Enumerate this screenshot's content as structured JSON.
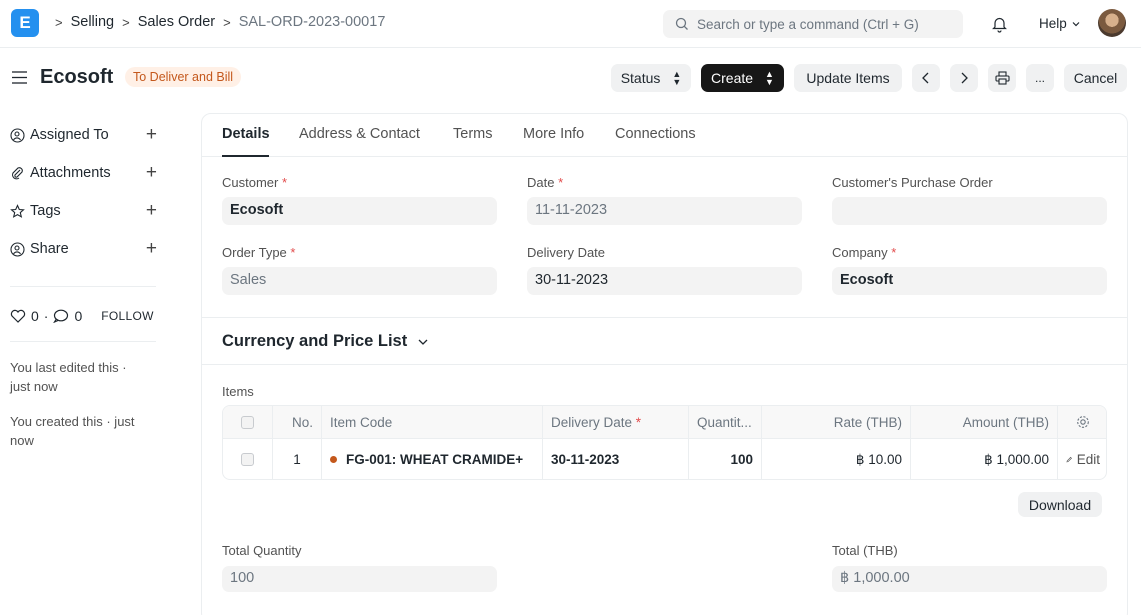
{
  "navbar": {
    "logo_letter": "E",
    "breadcrumbs": [
      "Selling",
      "Sales Order",
      "SAL-ORD-2023-00017"
    ],
    "search_placeholder": "Search or type a command (Ctrl + G)",
    "help_label": "Help"
  },
  "header": {
    "title": "Ecosoft",
    "status": "To Deliver and Bill",
    "status_label": "Status",
    "create_label": "Create",
    "update_items_label": "Update Items",
    "more_label": "...",
    "cancel_label": "Cancel"
  },
  "sidebar": {
    "items": [
      {
        "label": "Assigned To"
      },
      {
        "label": "Attachments"
      },
      {
        "label": "Tags"
      },
      {
        "label": "Share"
      }
    ],
    "likes": "0",
    "comments": "0",
    "follow": "FOLLOW",
    "last_edited": "You last edited this · just now",
    "created": "You created this · just now"
  },
  "tabs": [
    "Details",
    "Address & Contact",
    "Terms",
    "More Info",
    "Connections"
  ],
  "form": {
    "customer_label": "Customer",
    "customer": "Ecosoft",
    "date_label": "Date",
    "date": "11-11-2023",
    "cpo_label": "Customer's Purchase Order",
    "cpo": "",
    "order_type_label": "Order Type",
    "order_type": "Sales",
    "delivery_date_label": "Delivery Date",
    "delivery_date": "30-11-2023",
    "company_label": "Company",
    "company": "Ecosoft"
  },
  "currency_section": "Currency and Price List",
  "items": {
    "label": "Items",
    "columns": [
      "No.",
      "Item Code",
      "Delivery Date",
      "Quantit...",
      "Rate (THB)",
      "Amount (THB)"
    ],
    "rows": [
      {
        "no": "1",
        "item_code": "FG-001: WHEAT CRAMIDE+",
        "delivery_date": "30-11-2023",
        "qty": "100",
        "rate": "฿ 10.00",
        "amount": "฿ 1,000.00",
        "edit": "Edit"
      }
    ],
    "download_label": "Download"
  },
  "totals": {
    "total_qty_label": "Total Quantity",
    "total_qty": "100",
    "total_label": "Total (THB)",
    "total": "฿ 1,000.00"
  },
  "colors": {
    "accent": "#2490ef",
    "status": "#c4581c",
    "dark_button": "#171717"
  }
}
